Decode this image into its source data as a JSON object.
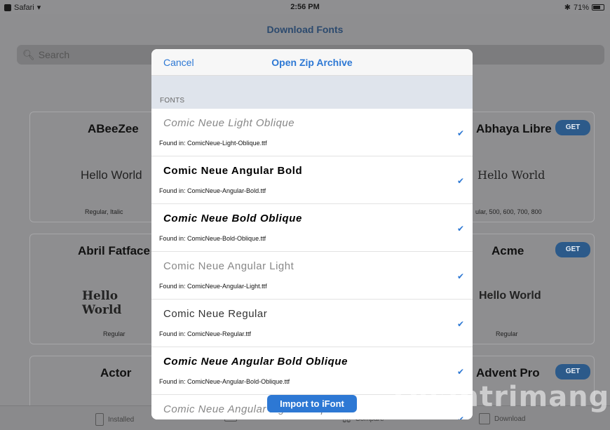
{
  "status_bar": {
    "app": "Safari",
    "time": "2:56 PM",
    "battery": "71%",
    "battery_level": 0.71
  },
  "nav": {
    "title": "Download Fonts"
  },
  "search": {
    "placeholder": "Search"
  },
  "cards": [
    {
      "title": "ABeeZee",
      "sample": "Hello World",
      "styles": "Regular, Italic"
    },
    {
      "title": "Abhaya Libre",
      "sample": "Hello World",
      "styles": "ular, 500, 600, 700, 800",
      "button": "GET"
    },
    {
      "title": "Abril Fatface",
      "sample": "Hello World",
      "styles": "Regular"
    },
    {
      "title": "Acme",
      "sample": "Hello World",
      "styles": "Regular",
      "button": "GET"
    },
    {
      "title": "Actor"
    },
    {
      "title": "Advent Pro",
      "button": "GET"
    }
  ],
  "tabs": [
    {
      "label": "Installed",
      "icon": "phone-icon"
    },
    {
      "label": "Files",
      "icon": "folder-icon"
    },
    {
      "label": "Compare",
      "icon": "scale-icon"
    },
    {
      "label": "Download",
      "icon": "download-icon"
    }
  ],
  "modal": {
    "cancel": "Cancel",
    "title": "Open Zip Archive",
    "section_label": "FONTS",
    "fonts": [
      {
        "name": "Comic Neue Light Oblique",
        "found": "Found in: ComicNeue-Light-Oblique.ttf",
        "checked": true
      },
      {
        "name": "Comic Neue Angular Bold",
        "found": "Found in: ComicNeue-Angular-Bold.ttf",
        "checked": true
      },
      {
        "name": "Comic Neue Bold Oblique",
        "found": "Found in: ComicNeue-Bold-Oblique.ttf",
        "checked": true
      },
      {
        "name": "Comic Neue Angular Light",
        "found": "Found in: ComicNeue-Angular-Light.ttf",
        "checked": true
      },
      {
        "name": "Comic Neue Regular",
        "found": "Found in: ComicNeue-Regular.ttf",
        "checked": true
      },
      {
        "name": "Comic Neue Angular Bold Oblique",
        "found": "Found in: ComicNeue-Angular-Bold-Oblique.ttf",
        "checked": true
      },
      {
        "name": "Comic Neue Angular Light Oblique",
        "found": "",
        "checked": true
      }
    ],
    "import_button": "Import to iFont"
  },
  "watermark": "Quantrimang",
  "colors": {
    "accent": "#2d78d4",
    "get_button": "#2c5a8a",
    "nav_title": "#2c4a6e"
  }
}
